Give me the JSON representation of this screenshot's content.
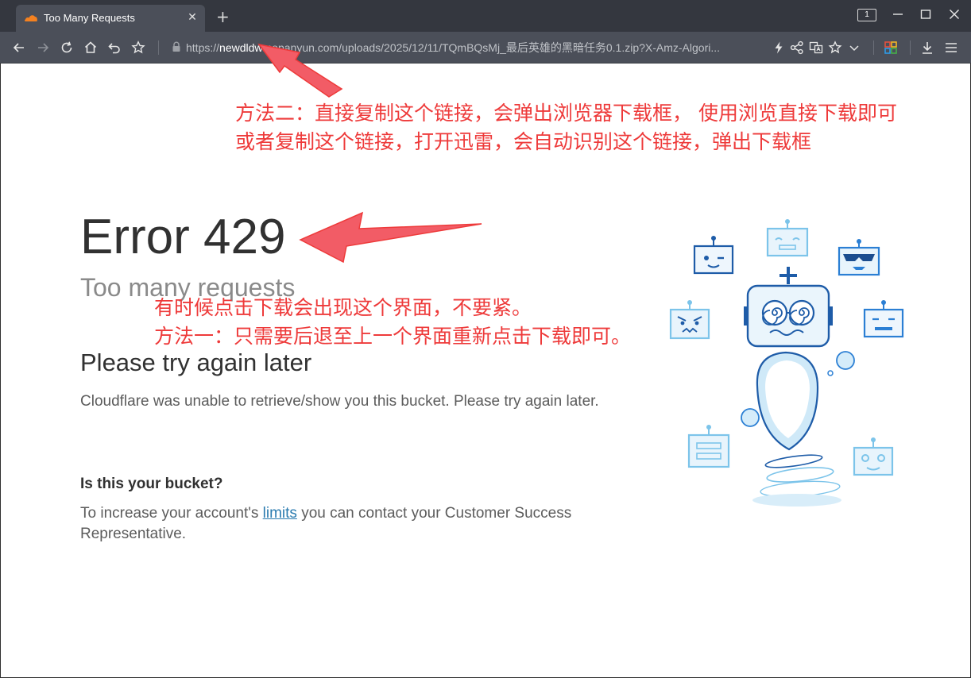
{
  "browser": {
    "tab_title": "Too Many Requests",
    "tab_close": "✕",
    "new_tab": "+",
    "tab_count": "1",
    "url_scheme": "https://",
    "url_host_visible": "newdldw",
    "url_rest": "mopanyun.com/uploads/2025/12/11/TQmBQsMj_最后英雄的黑暗任务0.1.zip?X-Amz-Algori..."
  },
  "page": {
    "error_title": "Error 429",
    "error_subtitle": "Too many requests",
    "try_again": "Please try again later",
    "description": "Cloudflare was unable to retrieve/show you this bucket. Please try again later.",
    "bucket_heading": "Is this your bucket?",
    "bucket_text_before": "To increase your account's ",
    "bucket_link": "limits",
    "bucket_text_after": " you can contact your Customer Success Representative."
  },
  "annotations": {
    "method2_line1": "方法二：直接复制这个链接，会弹出浏览器下载框， 使用浏览直接下载即可",
    "method2_line2": "或者复制这个链接，打开迅雷，会自动识别这个链接，弹出下载框",
    "note_line1": "有时候点击下载会出现这个界面，不要紧。",
    "note_line2": "方法一：只需要后退至上一个界面重新点击下载即可。"
  },
  "colors": {
    "annotation_red": "#ee3a3a",
    "link_blue": "#2c7cb0",
    "chrome_dark": "#34373f",
    "chrome_toolbar": "#4b4f59",
    "cloudflare_orange": "#f48120"
  },
  "icons": [
    "cloudflare-favicon-icon",
    "back-icon",
    "forward-icon",
    "reload-icon",
    "home-icon",
    "undo-icon",
    "bookmark-star-icon",
    "lock-icon",
    "lightning-icon",
    "share-icon",
    "translate-icon",
    "bookmark-add-icon",
    "chevron-down-icon",
    "apps-grid-icon",
    "download-icon",
    "menu-icon",
    "minimize-icon",
    "maximize-icon",
    "close-icon"
  ]
}
